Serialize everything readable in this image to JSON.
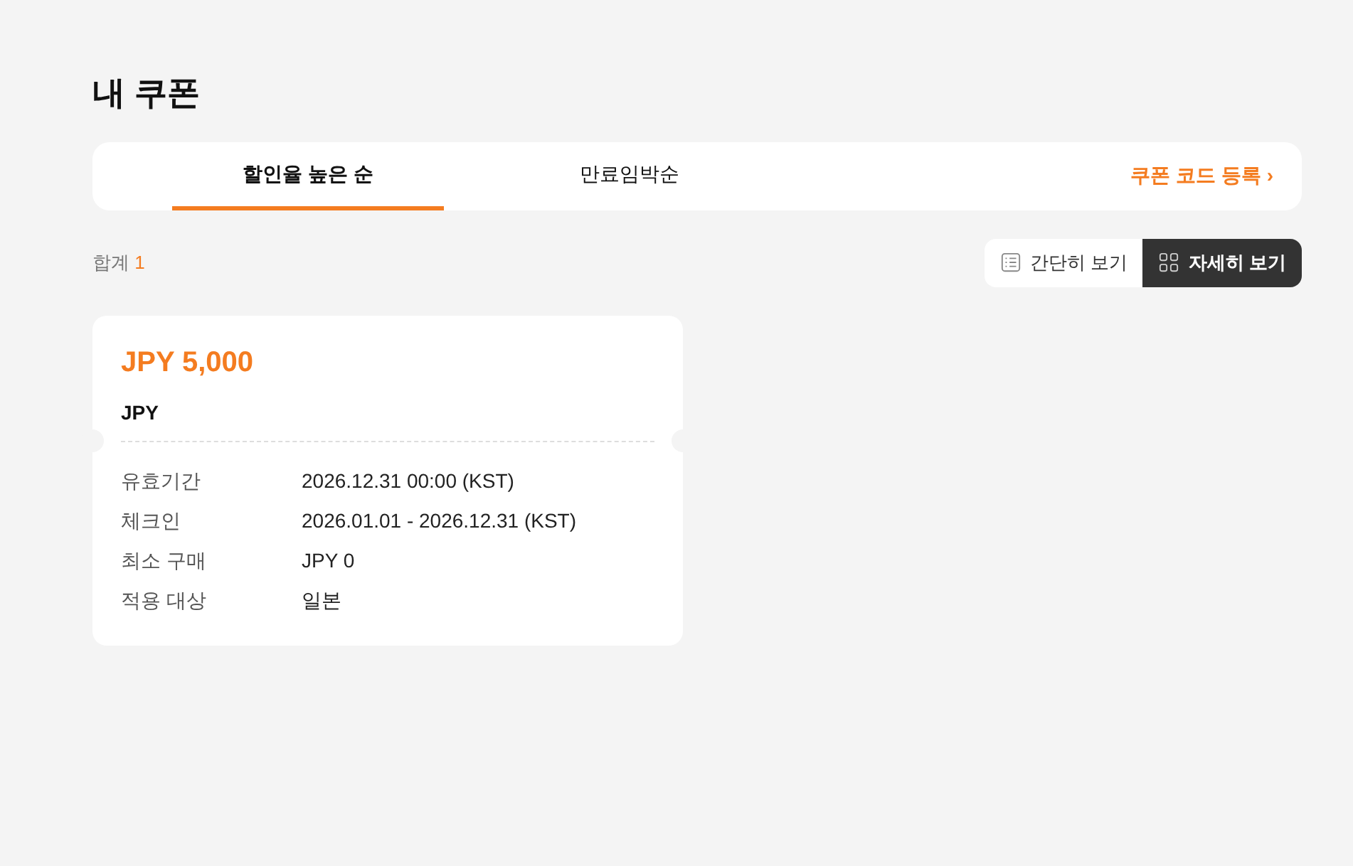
{
  "title": "내 쿠폰",
  "tabs": [
    {
      "label": "할인율 높은 순",
      "selected": true
    },
    {
      "label": "만료임박순",
      "selected": false
    }
  ],
  "register_link": {
    "label": "쿠폰 코드 등록",
    "chevron": "›"
  },
  "total": {
    "label": "합계",
    "count": "1"
  },
  "view_toggle": [
    {
      "kind": "list",
      "label": "간단히 보기",
      "selected": false
    },
    {
      "kind": "grid",
      "label": "자세히 보기",
      "selected": true
    }
  ],
  "coupons": [
    {
      "amount": "JPY 5,000",
      "name": "JPY",
      "details": [
        {
          "label": "유효기간",
          "value": "2026.12.31 00:00 (KST)"
        },
        {
          "label": "체크인",
          "value": "2026.01.01 - 2026.12.31 (KST)"
        },
        {
          "label": "최소 구매",
          "value": "JPY 0"
        },
        {
          "label": "적용 대상",
          "value": "일본"
        }
      ]
    }
  ]
}
